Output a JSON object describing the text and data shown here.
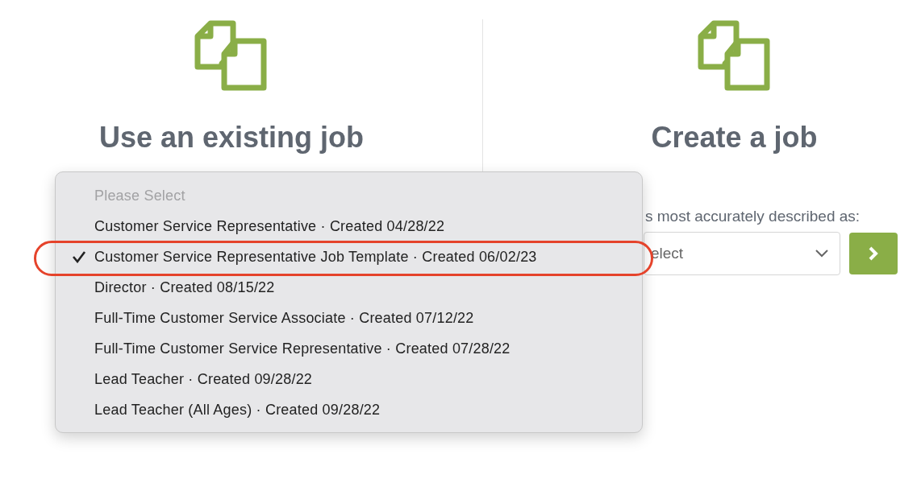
{
  "existing": {
    "heading": "Use an existing job",
    "menu": {
      "placeholder": "Please Select",
      "options": [
        {
          "label": "Customer Service Representative · Created 04/28/22",
          "selected": false
        },
        {
          "label": "Customer Service Representative Job Template · Created 06/02/23",
          "selected": true
        },
        {
          "label": "Director · Created 08/15/22",
          "selected": false
        },
        {
          "label": "Full-Time Customer Service Associate · Created 07/12/22",
          "selected": false
        },
        {
          "label": "Full-Time Customer Service Representative · Created 07/28/22",
          "selected": false
        },
        {
          "label": "Lead Teacher · Created 09/28/22",
          "selected": false
        },
        {
          "label": "Lead Teacher (All Ages) · Created 09/28/22",
          "selected": false
        }
      ]
    }
  },
  "create": {
    "heading": "Create a job",
    "prompt": "s most accurately described as:",
    "select": {
      "value": "elect"
    }
  }
}
